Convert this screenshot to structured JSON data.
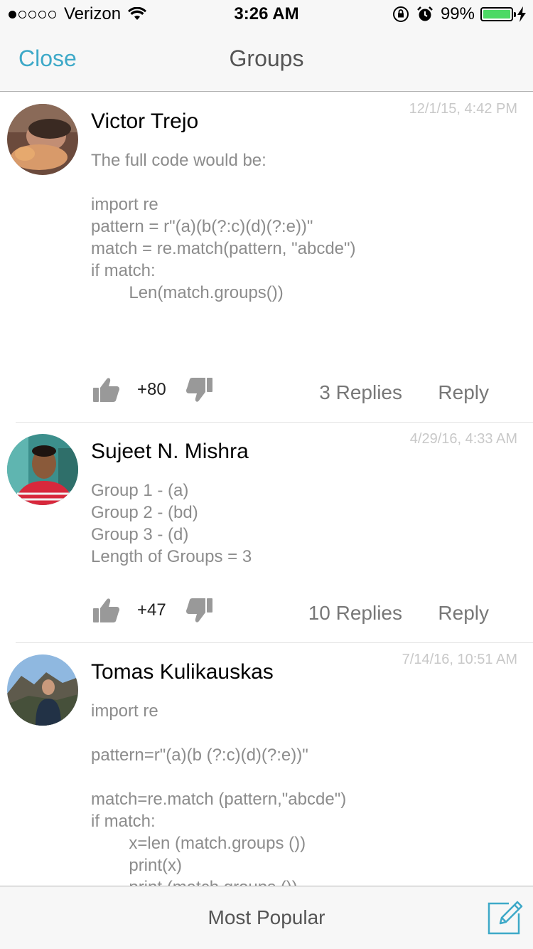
{
  "status_bar": {
    "carrier": "Verizon",
    "time": "3:26 AM",
    "battery": "99%",
    "battery_level": 0.99,
    "icons": [
      "signal-dots-icon",
      "wifi-icon",
      "rotation-lock-icon",
      "alarm-icon",
      "battery-icon",
      "charging-bolt-icon"
    ]
  },
  "nav": {
    "close_label": "Close",
    "title": "Groups"
  },
  "colors": {
    "accent": "#3ea9c8",
    "body_text": "#8c8c8c",
    "timestamp": "#c8c8c8",
    "battery": "#4cd964"
  },
  "comments": [
    {
      "author": "Victor Trejo",
      "timestamp": "12/1/15, 4:42 PM",
      "body": "The full code would be:\n\nimport re\npattern = r\"(a)(b(?:c)(d)(?:e))\"\nmatch = re.match(pattern, \"abcde\")\nif match:\n        Len(match.groups())",
      "score": "+80",
      "replies": "3 Replies",
      "reply_label": "Reply"
    },
    {
      "author": "Sujeet N. Mishra",
      "timestamp": "4/29/16, 4:33 AM",
      "body": "Group 1 - (a)\nGroup 2 - (bd)\nGroup 3 - (d)\nLength of Groups = 3",
      "score": "+47",
      "replies": "10 Replies",
      "reply_label": "Reply"
    },
    {
      "author": "Tomas Kulikauskas",
      "timestamp": "7/14/16, 10:51 AM",
      "body": "import re\n\npattern=r\"(a)(b (?:c)(d)(?:e))\"\n\nmatch=re.match (pattern,\"abcde\")\nif match:\n        x=len (match.groups ())\n        print(x)\n        print (match.groups ())"
    }
  ],
  "bottom_bar": {
    "sort_label": "Most Popular",
    "compose_icon": "compose-icon"
  }
}
